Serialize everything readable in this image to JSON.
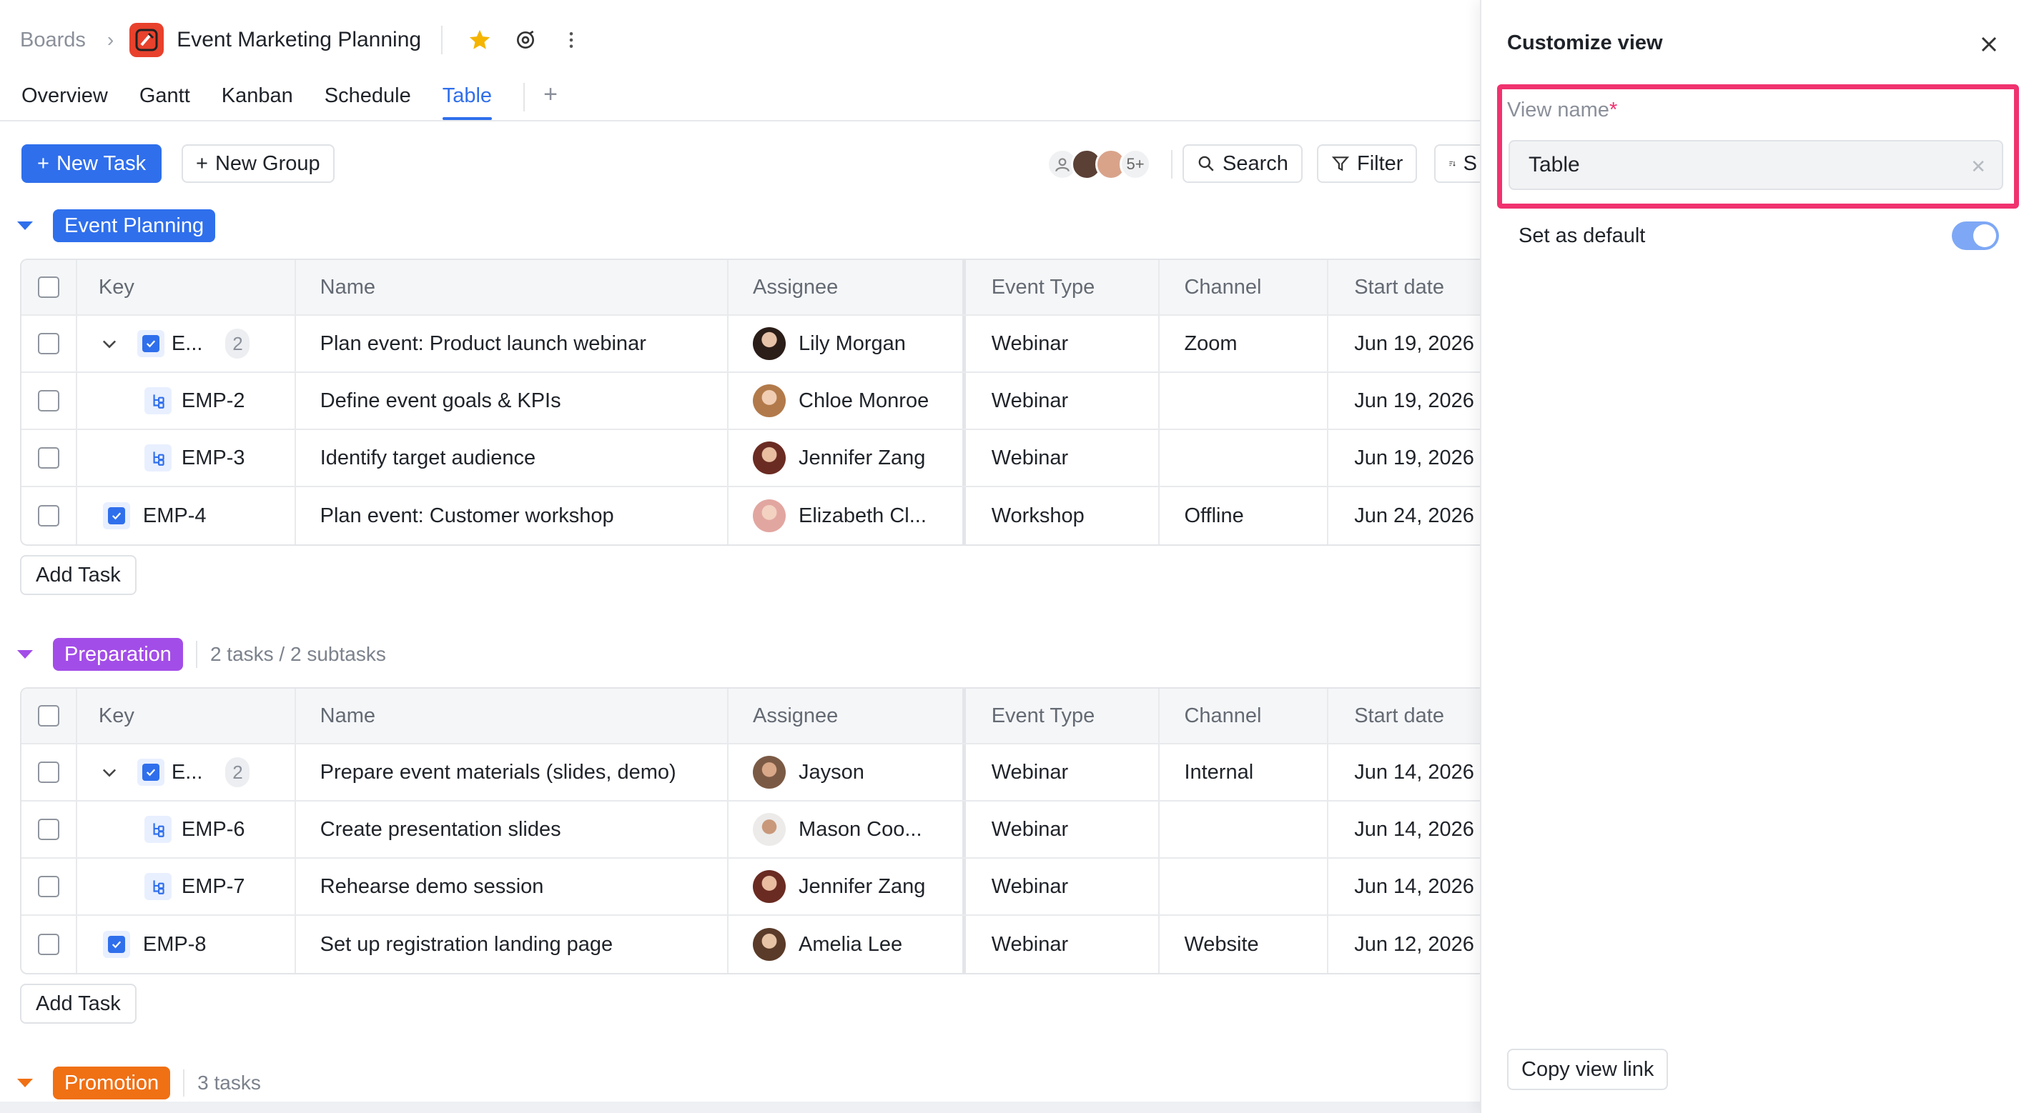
{
  "breadcrumb": {
    "root": "Boards",
    "board_title": "Event Marketing Planning"
  },
  "tabs": [
    {
      "label": "Overview",
      "active": false
    },
    {
      "label": "Gantt",
      "active": false
    },
    {
      "label": "Kanban",
      "active": false
    },
    {
      "label": "Schedule",
      "active": false
    },
    {
      "label": "Table",
      "active": true
    }
  ],
  "toolbar": {
    "new_task": "New Task",
    "new_group": "New Group",
    "more_avatars": "5+",
    "search": "Search",
    "filter": "Filter",
    "sort": "S"
  },
  "columns": {
    "key": "Key",
    "name": "Name",
    "assignee": "Assignee",
    "event_type": "Event Type",
    "channel": "Channel",
    "start_date": "Start date"
  },
  "groups": [
    {
      "name": "Event Planning",
      "color": "#2f6fec",
      "meta": "",
      "add_task": "Add Task",
      "rows": [
        {
          "key": "E...",
          "count": "2",
          "kind": "parent",
          "name": "Plan event: Product launch webinar",
          "assignee": "Lily Morgan",
          "event_type": "Webinar",
          "channel": "Zoom",
          "start_date": "Jun 19, 2026"
        },
        {
          "key": "EMP-2",
          "kind": "subtask",
          "name": "Define event goals & KPIs",
          "assignee": "Chloe Monroe",
          "event_type": "Webinar",
          "channel": "",
          "start_date": "Jun 19, 2026"
        },
        {
          "key": "EMP-3",
          "kind": "subtask",
          "name": "Identify target audience",
          "assignee": "Jennifer Zang",
          "event_type": "Webinar",
          "channel": "",
          "start_date": "Jun 19, 2026"
        },
        {
          "key": "EMP-4",
          "kind": "task",
          "name": "Plan event: Customer workshop",
          "assignee": "Elizabeth Cl...",
          "event_type": "Workshop",
          "channel": "Offline",
          "start_date": "Jun 24, 2026"
        }
      ]
    },
    {
      "name": "Preparation",
      "color": "#a34de8",
      "meta": "2 tasks / 2 subtasks",
      "add_task": "Add Task",
      "rows": [
        {
          "key": "E...",
          "count": "2",
          "kind": "parent",
          "name": "Prepare event materials (slides, demo)",
          "assignee": "Jayson",
          "event_type": "Webinar",
          "channel": "Internal",
          "start_date": "Jun 14, 2026"
        },
        {
          "key": "EMP-6",
          "kind": "subtask",
          "name": "Create presentation slides",
          "assignee": "Mason Coo...",
          "event_type": "Webinar",
          "channel": "",
          "start_date": "Jun 14, 2026"
        },
        {
          "key": "EMP-7",
          "kind": "subtask",
          "name": "Rehearse demo session",
          "assignee": "Jennifer Zang",
          "event_type": "Webinar",
          "channel": "",
          "start_date": "Jun 14, 2026"
        },
        {
          "key": "EMP-8",
          "kind": "task",
          "name": "Set up registration landing page",
          "assignee": "Amelia Lee",
          "event_type": "Webinar",
          "channel": "Website",
          "start_date": "Jun 12, 2026"
        }
      ]
    },
    {
      "name": "Promotion",
      "color": "#f07014",
      "meta": "3 tasks"
    }
  ],
  "panel": {
    "title": "Customize view",
    "field_label": "View name",
    "required_mark": "*",
    "field_value": "Table",
    "default_label": "Set as default",
    "default_on": true,
    "copy_link": "Copy view link"
  }
}
